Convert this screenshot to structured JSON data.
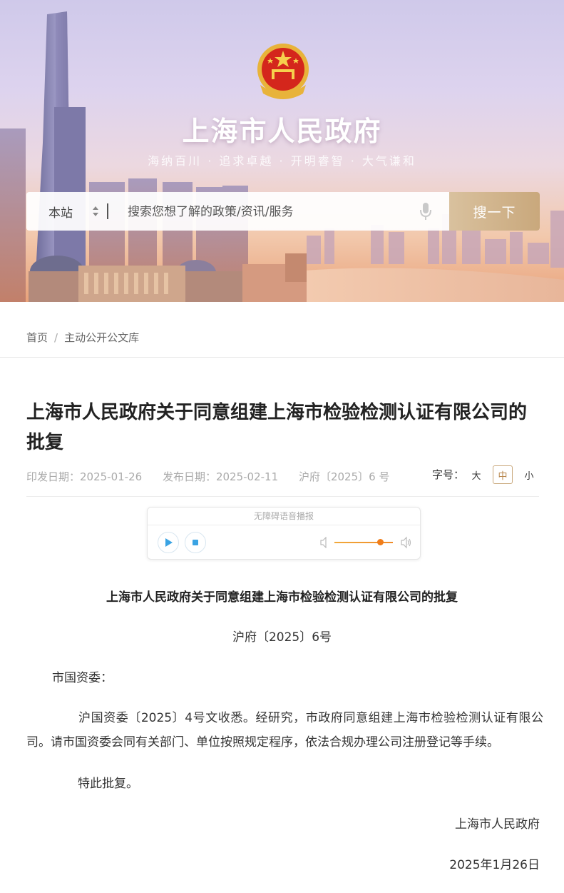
{
  "header": {
    "site_title": "上海市人民政府",
    "slogan": "海纳百川 · 追求卓越 · 开明睿智 · 大气谦和",
    "search": {
      "scope": "本站",
      "placeholder": "搜索您想了解的政策/资讯/服务",
      "button_label": "搜一下"
    }
  },
  "breadcrumb": {
    "home": "首页",
    "separator": "/",
    "current": "主动公开公文库"
  },
  "document": {
    "title": "上海市人民政府关于同意组建上海市检验检测认证有限公司的批复",
    "issue_date": "印发日期：2025-01-26",
    "publish_date": "发布日期：2025-02-11",
    "doc_number": "沪府〔2025〕6 号",
    "font_size": {
      "label": "字号：",
      "options": [
        "大",
        "中",
        "小"
      ],
      "selected": "中"
    }
  },
  "audio_player": {
    "title": "无障碍语音播报",
    "volume": 0.75,
    "accent_color": "#3aa3e3"
  },
  "content": {
    "title": "上海市人民政府关于同意组建上海市检验检测认证有限公司的批复",
    "doc_number": "沪府〔2025〕6号",
    "addressee": "市国资委：",
    "body": "沪国资委〔2025〕4号文收悉。经研究，市政府同意组建上海市检验检测认证有限公司。请市国资委会同有关部门、单位按照规定程序，依法合规办理公司注册登记等手续。",
    "closing": "特此批复。",
    "signature": "上海市人民政府",
    "date": "2025年1月26日"
  }
}
